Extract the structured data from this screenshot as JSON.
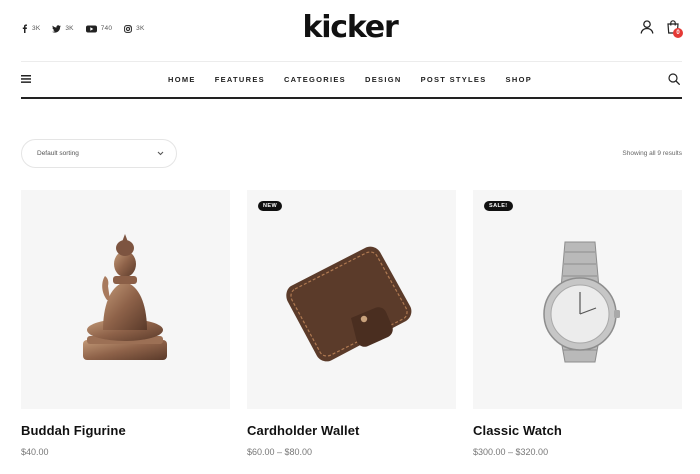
{
  "header": {
    "logo": "kicker",
    "social": [
      {
        "icon": "facebook-icon",
        "count": "3K"
      },
      {
        "icon": "twitter-icon",
        "count": "3K"
      },
      {
        "icon": "youtube-icon",
        "count": "740"
      },
      {
        "icon": "instagram-icon",
        "count": "3K"
      }
    ],
    "cart_count": "0"
  },
  "nav": {
    "items": [
      "HOME",
      "FEATURES",
      "CATEGORIES",
      "DESIGN",
      "POST STYLES",
      "SHOP"
    ]
  },
  "toolbar": {
    "sort_value": "Default sorting",
    "result_count": "Showing all 9 results"
  },
  "products": [
    {
      "title": "Buddah Figurine",
      "price": "$40.00",
      "badge": ""
    },
    {
      "title": "Cardholder Wallet",
      "price": "$60.00 – $80.00",
      "badge": "NEW"
    },
    {
      "title": "Classic Watch",
      "price": "$300.00 – $320.00",
      "badge": "SALE!"
    }
  ],
  "colors": {
    "accent_badge": "#e53935",
    "image_background": "#f6f6f6",
    "text": "#111111"
  }
}
